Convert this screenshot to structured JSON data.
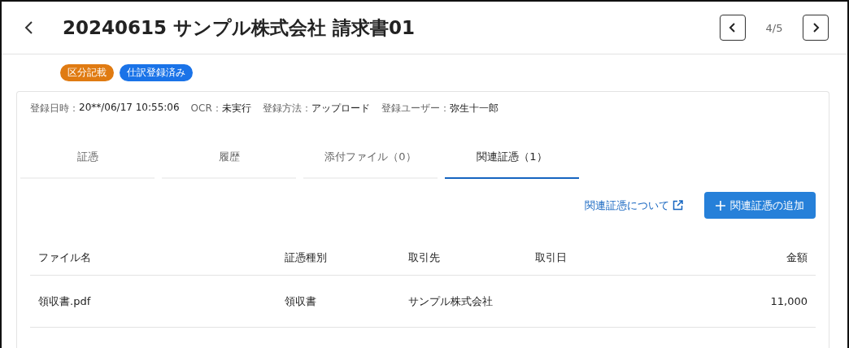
{
  "header": {
    "title": "20240615 サンプル株式会社 請求書01",
    "pager": "4/5"
  },
  "tags": [
    {
      "label": "区分記載",
      "color": "#e07b12"
    },
    {
      "label": "仕訳登録済み",
      "color": "#1a73e8"
    }
  ],
  "meta": [
    {
      "label": "登録日時：",
      "value": "20**/06/17 10:55:06"
    },
    {
      "label": "OCR：",
      "value": "未実行"
    },
    {
      "label": "登録方法：",
      "value": "アップロード"
    },
    {
      "label": "登録ユーザー：",
      "value": "弥生十一郎"
    }
  ],
  "tabs": [
    {
      "label": "証憑",
      "selected": false
    },
    {
      "label": "履歴",
      "selected": false
    },
    {
      "label": "添付ファイル（0）",
      "selected": false
    },
    {
      "label": "関連証憑（1）",
      "selected": true
    }
  ],
  "actions": {
    "link": "関連証憑について",
    "button": "関連証憑の追加"
  },
  "table": {
    "columns": [
      "ファイル名",
      "証憑種別",
      "取引先",
      "取引日",
      "金額"
    ],
    "rows": [
      [
        "領収書.pdf",
        "領収書",
        "サンプル株式会社",
        "",
        "11,000"
      ]
    ]
  }
}
